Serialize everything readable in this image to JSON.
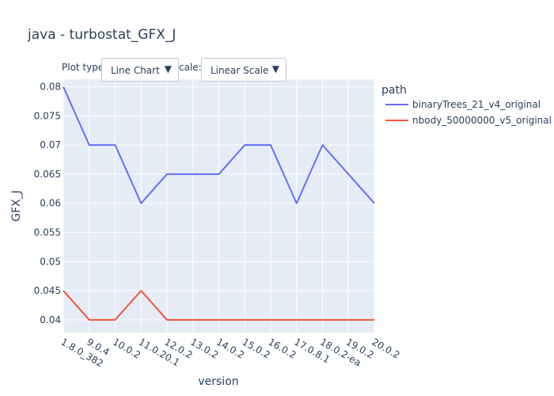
{
  "title": "java - turbostat_GFX_J",
  "controls": {
    "plot_type_label": "Plot type",
    "plot_type_value": "Line Chart",
    "scale_label": "cale:",
    "scale_value": "Linear Scale",
    "arrow_icon": "▼"
  },
  "colors": {
    "plot_bg": "#e5ecf6",
    "grid": "#ffffff",
    "series_1": "#636efa",
    "series_2": "#ef553b"
  },
  "chart_data": {
    "type": "line",
    "title": "java - turbostat_GFX_J",
    "xlabel": "version",
    "ylabel": "GFX_J",
    "categories": [
      "1.8.0_382",
      "9.0.4",
      "10.0.2",
      "11.0.20.1",
      "12.0.2",
      "13.0.2",
      "14.0.2",
      "15.0.2",
      "16.0.2",
      "17.0.8.1",
      "18.0.2-ea",
      "19.0.2",
      "20.0.2"
    ],
    "yticks": [
      "0.04",
      "0.045",
      "0.05",
      "0.055",
      "0.06",
      "0.065",
      "0.07",
      "0.075",
      "0.08"
    ],
    "ylim": [
      0.0378,
      0.0813
    ],
    "grid": true,
    "legend": {
      "title": "path",
      "position": "right"
    },
    "series": [
      {
        "name": "binaryTrees_21_v4_original",
        "values": [
          0.08,
          0.07,
          0.07,
          0.06,
          0.065,
          0.065,
          0.065,
          0.07,
          0.07,
          0.06,
          0.07,
          0.065,
          0.06
        ]
      },
      {
        "name": "nbody_50000000_v5_original",
        "values": [
          0.045,
          0.04,
          0.04,
          0.045,
          0.04,
          0.04,
          0.04,
          0.04,
          0.04,
          0.04,
          0.04,
          0.04,
          0.04
        ]
      }
    ]
  }
}
